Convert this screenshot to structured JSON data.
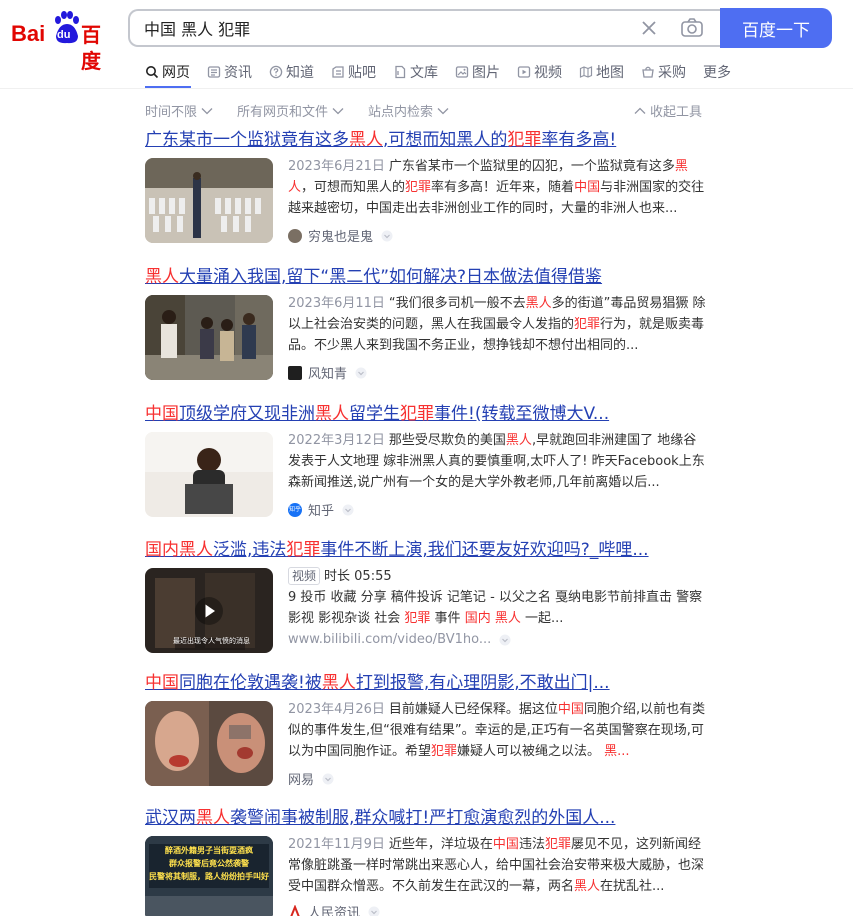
{
  "header": {
    "logo_bai": "Bai",
    "logo_du": "du",
    "logo_cn": "百度",
    "search_value": "中国 黑人 犯罪",
    "search_button": "百度一下"
  },
  "tabs": [
    {
      "label": "网页",
      "icon": "search-icon"
    },
    {
      "label": "资讯",
      "icon": "news-icon"
    },
    {
      "label": "知道",
      "icon": "question-icon"
    },
    {
      "label": "贴吧",
      "icon": "tieba-icon"
    },
    {
      "label": "文库",
      "icon": "doc-icon"
    },
    {
      "label": "图片",
      "icon": "image-icon"
    },
    {
      "label": "视频",
      "icon": "video-icon"
    },
    {
      "label": "地图",
      "icon": "map-icon"
    },
    {
      "label": "采购",
      "icon": "cart-icon"
    },
    {
      "label": "更多",
      "icon": ""
    }
  ],
  "filters": {
    "time": "时间不限",
    "type": "所有网页和文件",
    "site": "站点内检索",
    "collapse": "收起工具"
  },
  "results": [
    {
      "title_parts": [
        "广东某市一个监狱竟有这多",
        "黑人",
        ",可想而知黑人的",
        "犯罪",
        "率有多高!"
      ],
      "date": "2023年6月21日",
      "snippet_parts": [
        "广东省某市一个监狱里的囚犯，一个监狱竟有这多",
        "黑人",
        "，可想而知黑人的",
        "犯罪",
        "率有多高！近年来，随着",
        "中国",
        "与非洲国家的交往越来越密切，中国走出去非洲创业工作的同时，大量的非洲人也来..."
      ],
      "source": "穷鬼也是鬼"
    },
    {
      "title_parts": [
        "黑人",
        "大量涌入我国,留下“黑二代”如何解决?日本做法值得借鉴"
      ],
      "date": "2023年6月11日",
      "snippet_parts": [
        "“我们很多司机一般不去",
        "黑人",
        "多的街道”毒品贸易猖獗 除以上社会治安类的问题，黑人在我国最令人发指的",
        "犯罪",
        "行为，就是贩卖毒品。不少黑人来到我国不务正业，想挣钱却不想付出相同的..."
      ],
      "source": "风知青"
    },
    {
      "title_parts": [
        "中国",
        "顶级学府又现非洲",
        "黑人",
        "留学生",
        "犯罪",
        "事件!(转载至微博大V..."
      ],
      "date": "2022年3月12日",
      "snippet_parts": [
        "那些受尽欺负的美国",
        "黑人",
        ",早就跑回非洲建国了 地缘谷发表于人文地理 嫁非洲黑人真的要慎重啊,太吓人了! 昨天Facebook上东森新闻推送,说广州有一个女的是大学外教老师,几年前离婚以后..."
      ],
      "source": "知乎",
      "source_icon_text": "知乎"
    },
    {
      "title_parts": [
        "国内",
        "黑人",
        "泛滥,违法",
        "犯罪",
        "事件不断上演,我们还要友好欢迎吗?_哔哩..."
      ],
      "tag": "视频",
      "duration": "时长 05:55",
      "snippet_parts": [
        "9 投币 收藏 分享 稿件投诉 记笔记 - 以父之名 戛纳电影节前排直击 警察 影视 影视杂谈 社会 ",
        "犯罪",
        " 事件 ",
        "国内 黑人",
        " 一起..."
      ],
      "thumb_caption": "最近出现令人气愤的消息",
      "source": "www.bilibili.com/video/BV1ho..."
    },
    {
      "title_parts": [
        "中国",
        "同胞在伦敦遇袭!被",
        "黑人",
        "打到报警,有心理阴影,不敢出门|..."
      ],
      "date": "2023年4月26日",
      "snippet_parts": [
        "目前嫌疑人已经保释。据这位",
        "中国",
        "同胞介绍,以前也有类似的事件发生,但“很难有结果”。幸运的是,正巧有一名英国警察在现场,可以为中国同胞作证。希望",
        "犯罪",
        "嫌疑人可以被绳之以法。 ",
        "黑..."
      ],
      "source": "网易"
    },
    {
      "title_parts": [
        "武汉两",
        "黑人",
        "袭警闹事被制服,群众喊打!严打愈演愈烈的外国人..."
      ],
      "date": "2021年11月9日",
      "snippet_parts": [
        "近些年，洋垃圾在",
        "中国",
        "违法",
        "犯罪",
        "屡见不见，这列新闻经常像脏跳蚤一样时常跳出来恶心人，给中国社会治安带来极大威胁，也深受中国群众憎恶。不久前发生在武汉的一幕，两名",
        "黑人",
        "在扰乱社..."
      ],
      "thumb_caption_lines": [
        "醉酒外籍男子当街耍酒疯",
        "群众报警后竟公然袭警",
        "民警将其制服，路人纷纷拍手叫好"
      ],
      "source": "人民资讯"
    }
  ],
  "colors": {
    "accent": "#4e6ef2",
    "link": "#2440b3",
    "highlight": "#f73131",
    "logo_red": "#e10602",
    "logo_blue": "#2319dc"
  }
}
